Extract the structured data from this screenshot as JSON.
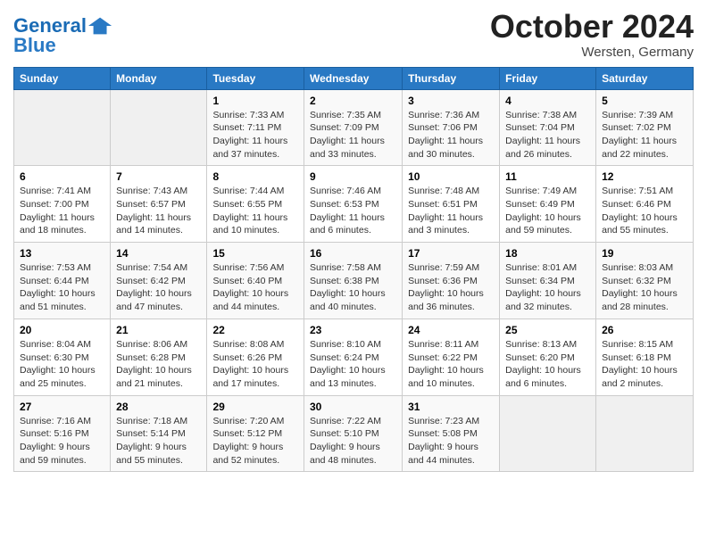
{
  "header": {
    "logo_line1": "General",
    "logo_line2": "Blue",
    "month": "October 2024",
    "location": "Wersten, Germany"
  },
  "weekdays": [
    "Sunday",
    "Monday",
    "Tuesday",
    "Wednesday",
    "Thursday",
    "Friday",
    "Saturday"
  ],
  "weeks": [
    [
      {
        "day": "",
        "sunrise": "",
        "sunset": "",
        "daylight": ""
      },
      {
        "day": "",
        "sunrise": "",
        "sunset": "",
        "daylight": ""
      },
      {
        "day": "1",
        "sunrise": "Sunrise: 7:33 AM",
        "sunset": "Sunset: 7:11 PM",
        "daylight": "Daylight: 11 hours and 37 minutes."
      },
      {
        "day": "2",
        "sunrise": "Sunrise: 7:35 AM",
        "sunset": "Sunset: 7:09 PM",
        "daylight": "Daylight: 11 hours and 33 minutes."
      },
      {
        "day": "3",
        "sunrise": "Sunrise: 7:36 AM",
        "sunset": "Sunset: 7:06 PM",
        "daylight": "Daylight: 11 hours and 30 minutes."
      },
      {
        "day": "4",
        "sunrise": "Sunrise: 7:38 AM",
        "sunset": "Sunset: 7:04 PM",
        "daylight": "Daylight: 11 hours and 26 minutes."
      },
      {
        "day": "5",
        "sunrise": "Sunrise: 7:39 AM",
        "sunset": "Sunset: 7:02 PM",
        "daylight": "Daylight: 11 hours and 22 minutes."
      }
    ],
    [
      {
        "day": "6",
        "sunrise": "Sunrise: 7:41 AM",
        "sunset": "Sunset: 7:00 PM",
        "daylight": "Daylight: 11 hours and 18 minutes."
      },
      {
        "day": "7",
        "sunrise": "Sunrise: 7:43 AM",
        "sunset": "Sunset: 6:57 PM",
        "daylight": "Daylight: 11 hours and 14 minutes."
      },
      {
        "day": "8",
        "sunrise": "Sunrise: 7:44 AM",
        "sunset": "Sunset: 6:55 PM",
        "daylight": "Daylight: 11 hours and 10 minutes."
      },
      {
        "day": "9",
        "sunrise": "Sunrise: 7:46 AM",
        "sunset": "Sunset: 6:53 PM",
        "daylight": "Daylight: 11 hours and 6 minutes."
      },
      {
        "day": "10",
        "sunrise": "Sunrise: 7:48 AM",
        "sunset": "Sunset: 6:51 PM",
        "daylight": "Daylight: 11 hours and 3 minutes."
      },
      {
        "day": "11",
        "sunrise": "Sunrise: 7:49 AM",
        "sunset": "Sunset: 6:49 PM",
        "daylight": "Daylight: 10 hours and 59 minutes."
      },
      {
        "day": "12",
        "sunrise": "Sunrise: 7:51 AM",
        "sunset": "Sunset: 6:46 PM",
        "daylight": "Daylight: 10 hours and 55 minutes."
      }
    ],
    [
      {
        "day": "13",
        "sunrise": "Sunrise: 7:53 AM",
        "sunset": "Sunset: 6:44 PM",
        "daylight": "Daylight: 10 hours and 51 minutes."
      },
      {
        "day": "14",
        "sunrise": "Sunrise: 7:54 AM",
        "sunset": "Sunset: 6:42 PM",
        "daylight": "Daylight: 10 hours and 47 minutes."
      },
      {
        "day": "15",
        "sunrise": "Sunrise: 7:56 AM",
        "sunset": "Sunset: 6:40 PM",
        "daylight": "Daylight: 10 hours and 44 minutes."
      },
      {
        "day": "16",
        "sunrise": "Sunrise: 7:58 AM",
        "sunset": "Sunset: 6:38 PM",
        "daylight": "Daylight: 10 hours and 40 minutes."
      },
      {
        "day": "17",
        "sunrise": "Sunrise: 7:59 AM",
        "sunset": "Sunset: 6:36 PM",
        "daylight": "Daylight: 10 hours and 36 minutes."
      },
      {
        "day": "18",
        "sunrise": "Sunrise: 8:01 AM",
        "sunset": "Sunset: 6:34 PM",
        "daylight": "Daylight: 10 hours and 32 minutes."
      },
      {
        "day": "19",
        "sunrise": "Sunrise: 8:03 AM",
        "sunset": "Sunset: 6:32 PM",
        "daylight": "Daylight: 10 hours and 28 minutes."
      }
    ],
    [
      {
        "day": "20",
        "sunrise": "Sunrise: 8:04 AM",
        "sunset": "Sunset: 6:30 PM",
        "daylight": "Daylight: 10 hours and 25 minutes."
      },
      {
        "day": "21",
        "sunrise": "Sunrise: 8:06 AM",
        "sunset": "Sunset: 6:28 PM",
        "daylight": "Daylight: 10 hours and 21 minutes."
      },
      {
        "day": "22",
        "sunrise": "Sunrise: 8:08 AM",
        "sunset": "Sunset: 6:26 PM",
        "daylight": "Daylight: 10 hours and 17 minutes."
      },
      {
        "day": "23",
        "sunrise": "Sunrise: 8:10 AM",
        "sunset": "Sunset: 6:24 PM",
        "daylight": "Daylight: 10 hours and 13 minutes."
      },
      {
        "day": "24",
        "sunrise": "Sunrise: 8:11 AM",
        "sunset": "Sunset: 6:22 PM",
        "daylight": "Daylight: 10 hours and 10 minutes."
      },
      {
        "day": "25",
        "sunrise": "Sunrise: 8:13 AM",
        "sunset": "Sunset: 6:20 PM",
        "daylight": "Daylight: 10 hours and 6 minutes."
      },
      {
        "day": "26",
        "sunrise": "Sunrise: 8:15 AM",
        "sunset": "Sunset: 6:18 PM",
        "daylight": "Daylight: 10 hours and 2 minutes."
      }
    ],
    [
      {
        "day": "27",
        "sunrise": "Sunrise: 7:16 AM",
        "sunset": "Sunset: 5:16 PM",
        "daylight": "Daylight: 9 hours and 59 minutes."
      },
      {
        "day": "28",
        "sunrise": "Sunrise: 7:18 AM",
        "sunset": "Sunset: 5:14 PM",
        "daylight": "Daylight: 9 hours and 55 minutes."
      },
      {
        "day": "29",
        "sunrise": "Sunrise: 7:20 AM",
        "sunset": "Sunset: 5:12 PM",
        "daylight": "Daylight: 9 hours and 52 minutes."
      },
      {
        "day": "30",
        "sunrise": "Sunrise: 7:22 AM",
        "sunset": "Sunset: 5:10 PM",
        "daylight": "Daylight: 9 hours and 48 minutes."
      },
      {
        "day": "31",
        "sunrise": "Sunrise: 7:23 AM",
        "sunset": "Sunset: 5:08 PM",
        "daylight": "Daylight: 9 hours and 44 minutes."
      },
      {
        "day": "",
        "sunrise": "",
        "sunset": "",
        "daylight": ""
      },
      {
        "day": "",
        "sunrise": "",
        "sunset": "",
        "daylight": ""
      }
    ]
  ]
}
